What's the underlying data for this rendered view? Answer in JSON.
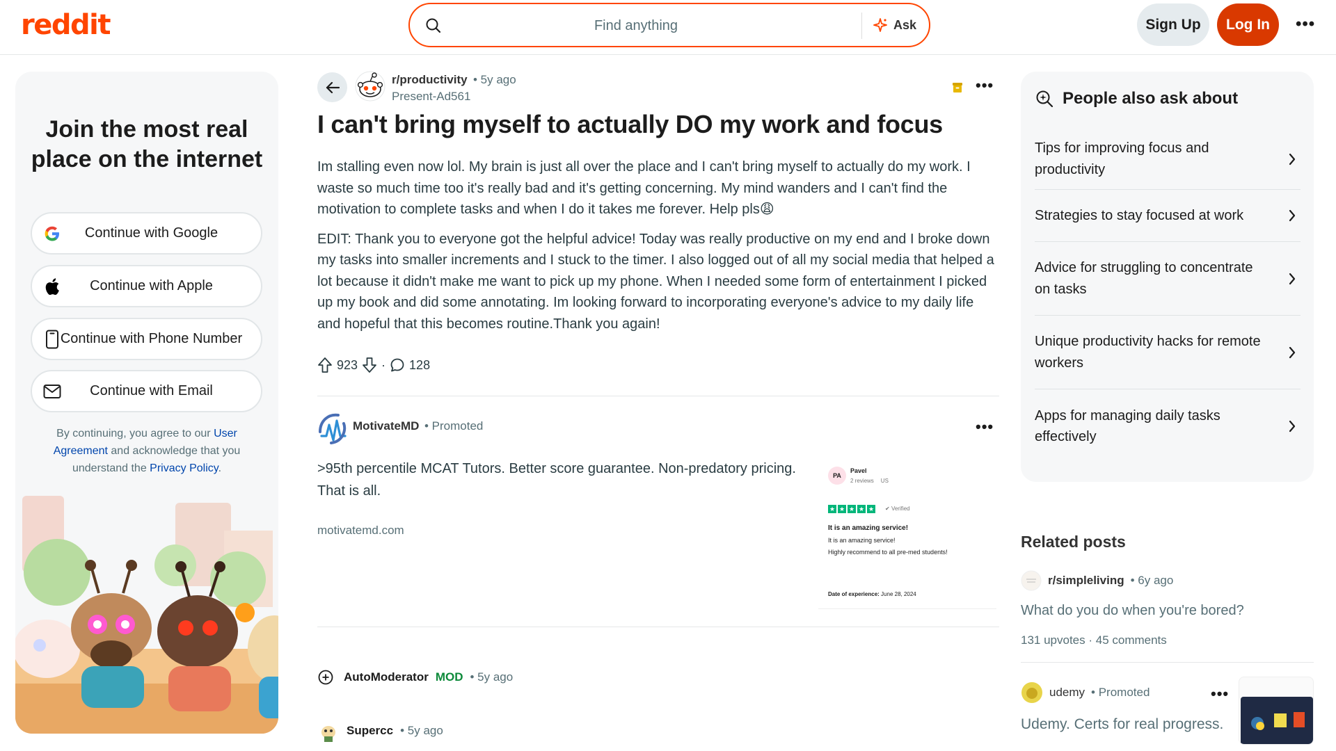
{
  "header": {
    "logo": "reddit",
    "search_placeholder": "Find anything",
    "ask_label": "Ask",
    "signup_label": "Sign Up",
    "login_label": "Log In",
    "more_label": "•••"
  },
  "left_panel": {
    "heading": "Join the most real place on the internet",
    "buttons": [
      {
        "label": "Continue with Google",
        "icon": "google-icon"
      },
      {
        "label": "Continue with Apple",
        "icon": "apple-icon"
      },
      {
        "label": "Continue with Phone Number",
        "icon": "phone-icon"
      },
      {
        "label": "Continue with Email",
        "icon": "mail-icon"
      }
    ],
    "terms": {
      "prefix": "By continuing, you agree to our ",
      "user_agreement": "User Agreement",
      "middle": " and acknowledge that you understand the ",
      "privacy_policy": "Privacy Policy",
      "suffix": "."
    }
  },
  "post": {
    "subreddit": "r/productivity",
    "time": "• 5y ago",
    "author": "Present-Ad561",
    "title": "I can't bring myself to actually DO my work and focus",
    "body_1": "Im stalling even now lol. My brain is just all over the place and I can't bring myself to actually do my work. I waste so much time too it's really bad and it's getting concerning. My mind wanders and I can't find the motivation to complete tasks and when I do it takes me forever. Help pls😩",
    "body_2": "EDIT: Thank you to everyone got the helpful advice! Today was really productive on my end and I broke down my tasks into smaller increments and I stuck to the timer. I also logged out of all my social media that helped a lot because it didn't make me want to pick up my phone. When I needed some form of entertainment I picked up my book and did some annotating. Im looking forward to incorporating everyone's advice to my daily life and hopeful that this becomes routine.Thank you again!",
    "upvotes": "923",
    "separator": "·",
    "comments": "128"
  },
  "ad": {
    "name": "MotivateMD",
    "promoted": "• Promoted",
    "text": ">95th percentile MCAT Tutors. Better score guarantee. Non-predatory pricing. That is all.",
    "url": "motivatemd.com",
    "review": {
      "initials": "PA",
      "reviewer": "Pavel",
      "reviews_count": "2 reviews",
      "country": "US",
      "verified": "Verified",
      "headline": "It is an amazing service!",
      "line1": "It is an amazing service!",
      "line2": "Highly recommend to all pre-med students!",
      "date_label": "Date of experience:",
      "date": "June 28, 2024"
    }
  },
  "comments": {
    "mod_name": "AutoModerator",
    "mod_badge": "MOD",
    "mod_time": "• 5y ago",
    "user_name": "Supercc",
    "user_time": "• 5y ago"
  },
  "right_panel": {
    "heading": "People also ask about",
    "questions": [
      "Tips for improving focus and productivity",
      "Strategies to stay focused at work",
      "Advice for struggling to concentrate on tasks",
      "Unique productivity hacks for remote workers",
      "Apps for managing daily tasks effectively"
    ],
    "related_heading": "Related posts",
    "related": {
      "subreddit": "r/simpleliving",
      "time": "• 6y ago",
      "title": "What do you do when you're bored?",
      "stats": "131 upvotes · 45 comments"
    },
    "promo": {
      "name": "udemy",
      "promoted": "• Promoted",
      "title": "Udemy. Certs for real progress."
    }
  },
  "colors": {
    "brand": "#ff4500",
    "login": "#d93900",
    "link": "#0045ac",
    "mod": "#0d8a3a"
  }
}
